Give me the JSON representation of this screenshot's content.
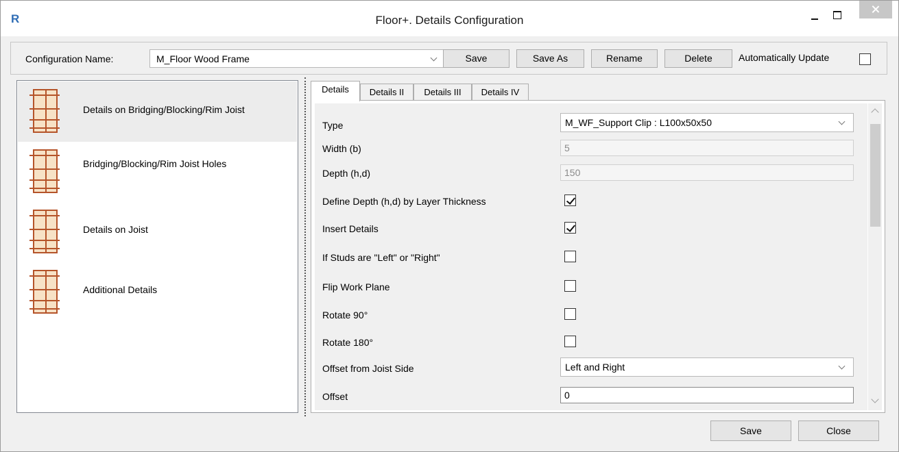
{
  "window": {
    "title": "Floor+. Details Configuration",
    "app_icon": "revit-r-icon",
    "accent_color": "#2f6db5"
  },
  "config": {
    "label": "Configuration Name:",
    "selected": "M_Floor Wood Frame",
    "save": "Save",
    "save_as": "Save As",
    "rename": "Rename",
    "delete": "Delete",
    "auto_update_label": "Automatically Update",
    "auto_update_checked": false
  },
  "left_list": [
    {
      "label": "Details on Bridging/Blocking/Rim Joist",
      "icon": "floor-frame-icon",
      "selected": true
    },
    {
      "label": "Bridging/Blocking/Rim Joist Holes",
      "icon": "floor-frame-icon",
      "selected": false
    },
    {
      "label": "Details on Joist",
      "icon": "floor-frame-icon",
      "selected": false
    },
    {
      "label": "Additional Details",
      "icon": "floor-frame-icon",
      "selected": false
    }
  ],
  "tabs": [
    "Details",
    "Details II",
    "Details III",
    "Details IV"
  ],
  "active_tab": "Details",
  "properties": {
    "type": {
      "label": "Type",
      "value": "M_WF_Support Clip : L100x50x50"
    },
    "width": {
      "label": "Width (b)",
      "value": "5"
    },
    "depth": {
      "label": "Depth (h,d)",
      "value": "150"
    },
    "define_depth": {
      "label": "Define Depth (h,d) by Layer Thickness",
      "checked": true
    },
    "insert_details": {
      "label": "Insert Details",
      "checked": true
    },
    "studs_lr": {
      "label": "If Studs are \"Left\" or \"Right\"",
      "checked": false
    },
    "flip_plane": {
      "label": "Flip Work Plane",
      "checked": false
    },
    "rotate_90": {
      "label": "Rotate 90°",
      "checked": false
    },
    "rotate_180": {
      "label": "Rotate 180°",
      "checked": false
    },
    "offset_side": {
      "label": "Offset from Joist Side",
      "value": "Left and Right"
    },
    "offset": {
      "label": "Offset",
      "value": "0"
    }
  },
  "footer": {
    "save": "Save",
    "close": "Close"
  }
}
